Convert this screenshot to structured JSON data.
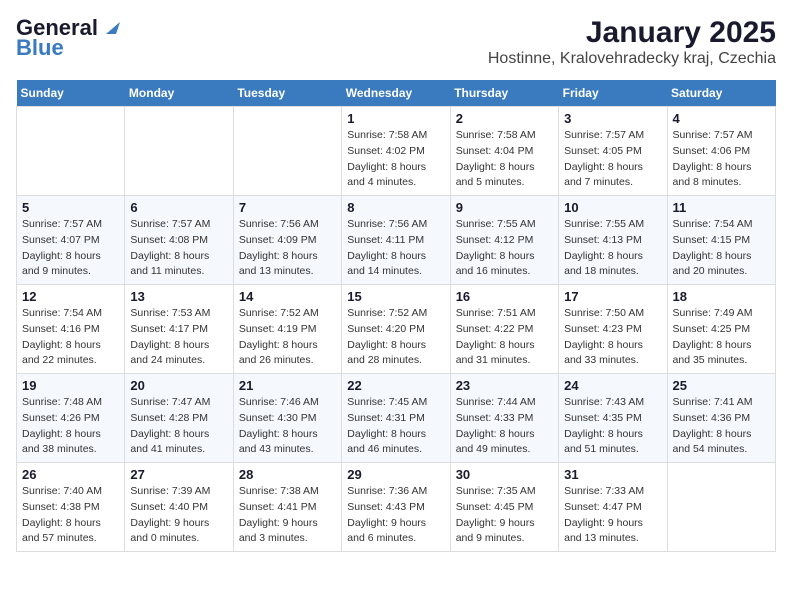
{
  "logo": {
    "general": "General",
    "blue": "Blue"
  },
  "title": "January 2025",
  "subtitle": "Hostinne, Kralovehradecky kraj, Czechia",
  "headers": [
    "Sunday",
    "Monday",
    "Tuesday",
    "Wednesday",
    "Thursday",
    "Friday",
    "Saturday"
  ],
  "weeks": [
    [
      {
        "day": "",
        "detail": ""
      },
      {
        "day": "",
        "detail": ""
      },
      {
        "day": "",
        "detail": ""
      },
      {
        "day": "1",
        "detail": "Sunrise: 7:58 AM\nSunset: 4:02 PM\nDaylight: 8 hours\nand 4 minutes."
      },
      {
        "day": "2",
        "detail": "Sunrise: 7:58 AM\nSunset: 4:04 PM\nDaylight: 8 hours\nand 5 minutes."
      },
      {
        "day": "3",
        "detail": "Sunrise: 7:57 AM\nSunset: 4:05 PM\nDaylight: 8 hours\nand 7 minutes."
      },
      {
        "day": "4",
        "detail": "Sunrise: 7:57 AM\nSunset: 4:06 PM\nDaylight: 8 hours\nand 8 minutes."
      }
    ],
    [
      {
        "day": "5",
        "detail": "Sunrise: 7:57 AM\nSunset: 4:07 PM\nDaylight: 8 hours\nand 9 minutes."
      },
      {
        "day": "6",
        "detail": "Sunrise: 7:57 AM\nSunset: 4:08 PM\nDaylight: 8 hours\nand 11 minutes."
      },
      {
        "day": "7",
        "detail": "Sunrise: 7:56 AM\nSunset: 4:09 PM\nDaylight: 8 hours\nand 13 minutes."
      },
      {
        "day": "8",
        "detail": "Sunrise: 7:56 AM\nSunset: 4:11 PM\nDaylight: 8 hours\nand 14 minutes."
      },
      {
        "day": "9",
        "detail": "Sunrise: 7:55 AM\nSunset: 4:12 PM\nDaylight: 8 hours\nand 16 minutes."
      },
      {
        "day": "10",
        "detail": "Sunrise: 7:55 AM\nSunset: 4:13 PM\nDaylight: 8 hours\nand 18 minutes."
      },
      {
        "day": "11",
        "detail": "Sunrise: 7:54 AM\nSunset: 4:15 PM\nDaylight: 8 hours\nand 20 minutes."
      }
    ],
    [
      {
        "day": "12",
        "detail": "Sunrise: 7:54 AM\nSunset: 4:16 PM\nDaylight: 8 hours\nand 22 minutes."
      },
      {
        "day": "13",
        "detail": "Sunrise: 7:53 AM\nSunset: 4:17 PM\nDaylight: 8 hours\nand 24 minutes."
      },
      {
        "day": "14",
        "detail": "Sunrise: 7:52 AM\nSunset: 4:19 PM\nDaylight: 8 hours\nand 26 minutes."
      },
      {
        "day": "15",
        "detail": "Sunrise: 7:52 AM\nSunset: 4:20 PM\nDaylight: 8 hours\nand 28 minutes."
      },
      {
        "day": "16",
        "detail": "Sunrise: 7:51 AM\nSunset: 4:22 PM\nDaylight: 8 hours\nand 31 minutes."
      },
      {
        "day": "17",
        "detail": "Sunrise: 7:50 AM\nSunset: 4:23 PM\nDaylight: 8 hours\nand 33 minutes."
      },
      {
        "day": "18",
        "detail": "Sunrise: 7:49 AM\nSunset: 4:25 PM\nDaylight: 8 hours\nand 35 minutes."
      }
    ],
    [
      {
        "day": "19",
        "detail": "Sunrise: 7:48 AM\nSunset: 4:26 PM\nDaylight: 8 hours\nand 38 minutes."
      },
      {
        "day": "20",
        "detail": "Sunrise: 7:47 AM\nSunset: 4:28 PM\nDaylight: 8 hours\nand 41 minutes."
      },
      {
        "day": "21",
        "detail": "Sunrise: 7:46 AM\nSunset: 4:30 PM\nDaylight: 8 hours\nand 43 minutes."
      },
      {
        "day": "22",
        "detail": "Sunrise: 7:45 AM\nSunset: 4:31 PM\nDaylight: 8 hours\nand 46 minutes."
      },
      {
        "day": "23",
        "detail": "Sunrise: 7:44 AM\nSunset: 4:33 PM\nDaylight: 8 hours\nand 49 minutes."
      },
      {
        "day": "24",
        "detail": "Sunrise: 7:43 AM\nSunset: 4:35 PM\nDaylight: 8 hours\nand 51 minutes."
      },
      {
        "day": "25",
        "detail": "Sunrise: 7:41 AM\nSunset: 4:36 PM\nDaylight: 8 hours\nand 54 minutes."
      }
    ],
    [
      {
        "day": "26",
        "detail": "Sunrise: 7:40 AM\nSunset: 4:38 PM\nDaylight: 8 hours\nand 57 minutes."
      },
      {
        "day": "27",
        "detail": "Sunrise: 7:39 AM\nSunset: 4:40 PM\nDaylight: 9 hours\nand 0 minutes."
      },
      {
        "day": "28",
        "detail": "Sunrise: 7:38 AM\nSunset: 4:41 PM\nDaylight: 9 hours\nand 3 minutes."
      },
      {
        "day": "29",
        "detail": "Sunrise: 7:36 AM\nSunset: 4:43 PM\nDaylight: 9 hours\nand 6 minutes."
      },
      {
        "day": "30",
        "detail": "Sunrise: 7:35 AM\nSunset: 4:45 PM\nDaylight: 9 hours\nand 9 minutes."
      },
      {
        "day": "31",
        "detail": "Sunrise: 7:33 AM\nSunset: 4:47 PM\nDaylight: 9 hours\nand 13 minutes."
      },
      {
        "day": "",
        "detail": ""
      }
    ]
  ]
}
